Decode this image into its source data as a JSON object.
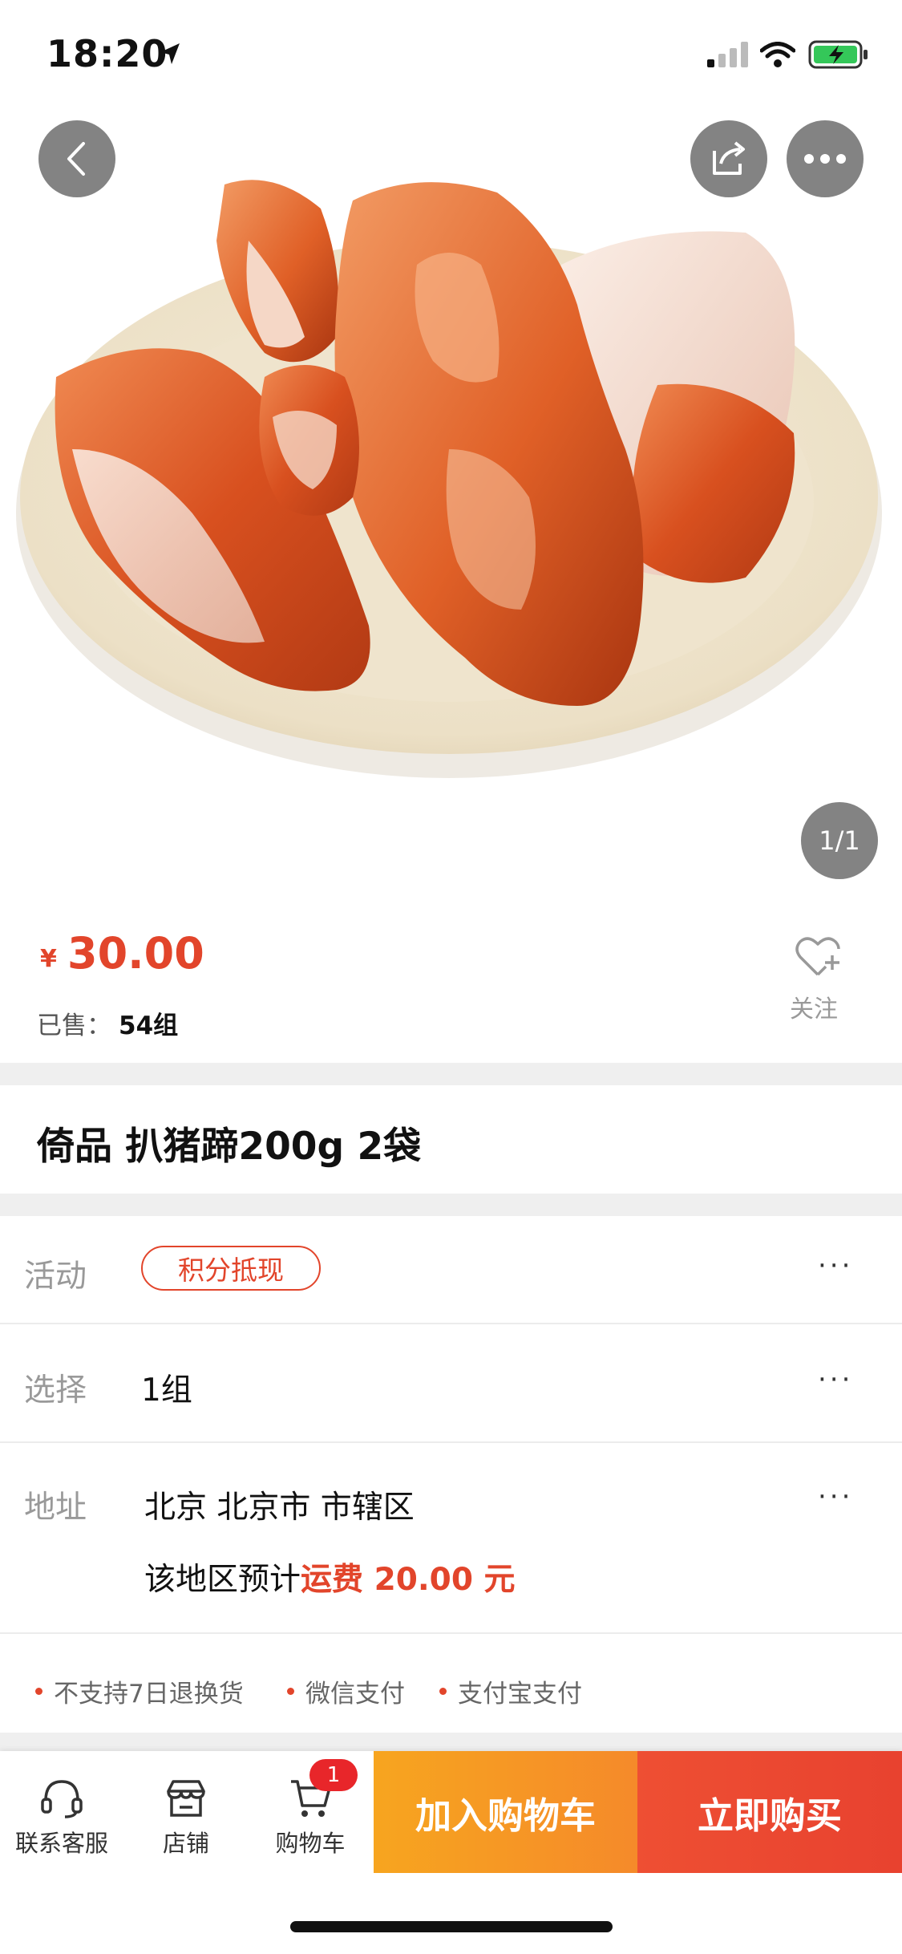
{
  "status_bar": {
    "time": "18:20"
  },
  "gallery": {
    "pager": "1/1"
  },
  "price": {
    "currency": "¥",
    "amount": "30.00"
  },
  "sales": {
    "label": "已售：",
    "value": "54组"
  },
  "follow": {
    "label": "关注"
  },
  "product": {
    "title": "倚品 扒猪蹄200g 2袋"
  },
  "rows": {
    "activity": {
      "label": "活动",
      "badge": "积分抵现"
    },
    "select": {
      "label": "选择",
      "value": "1组"
    },
    "address": {
      "label": "地址",
      "value": "北京 北京市 市辖区",
      "shipping_prefix": "该地区预计",
      "shipping_fee": "运费 20.00 元"
    }
  },
  "services": [
    "不支持7日退换货",
    "微信支付",
    "支付宝支付"
  ],
  "bottom_bar": {
    "service_label": "联系客服",
    "store_label": "店铺",
    "cart_label": "购物车",
    "cart_count": "1",
    "add_to_cart": "加入购物车",
    "buy_now": "立即购买"
  },
  "colors": {
    "accent": "#e2452b",
    "cart_button": "#f7a51f",
    "buy_button": "#ee4f33"
  }
}
